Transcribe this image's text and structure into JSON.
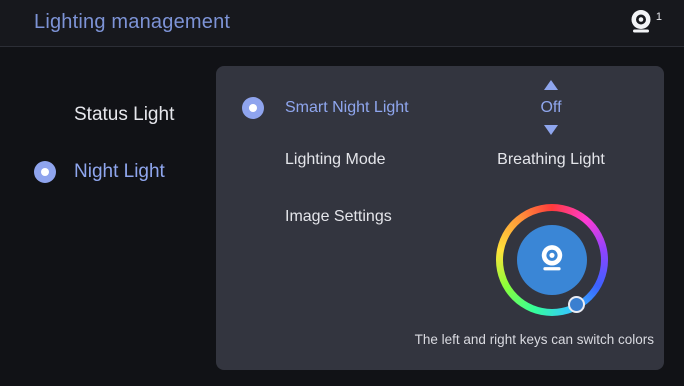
{
  "header": {
    "title": "Lighting management",
    "camera_count": "1"
  },
  "menu": {
    "items": [
      {
        "label": "Status Light",
        "selected": false
      },
      {
        "label": "Night Light",
        "selected": true
      }
    ]
  },
  "panel": {
    "smart_night_light": {
      "label": "Smart Night Light",
      "value": "Off",
      "selected": true
    },
    "lighting_mode": {
      "label": "Lighting Mode",
      "value": "Breathing Light"
    },
    "image_settings": {
      "label": "Image Settings"
    },
    "hint": "The left and right keys can switch colors"
  },
  "colors": {
    "accent": "#8fa6ee",
    "panel_bg": "#33353f",
    "wheel_center": "#3a86d6"
  },
  "icons": {
    "header_status": "camera-icon",
    "wheel_center": "camera-icon",
    "value_up": "triangle-up-icon",
    "value_down": "triangle-down-icon"
  }
}
